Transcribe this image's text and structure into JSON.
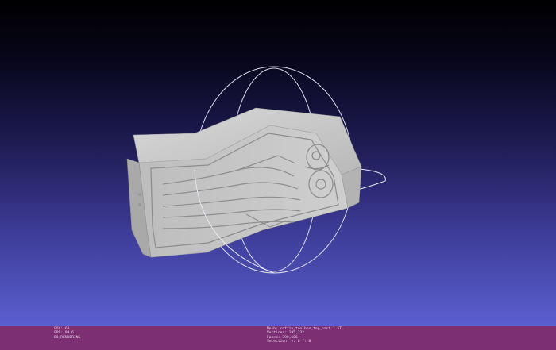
{
  "viewport": {
    "model_description": "3D mesh: coffin-shaped tool box part",
    "background_top": "#000000",
    "background_bottom": "#5b5fd0",
    "mesh_color": "#c9c9c9",
    "trackball_color": "#d9d9e6",
    "trackball_axis_accent": "#8fe08f"
  },
  "status_bar": {
    "color": "#7c2f72",
    "left_lines": [
      "FOV: 60",
      "FPS:   99.6",
      "BO_RENDERING"
    ],
    "right_lines": [
      "Mesh: coffin_toolbox_top_part 1.STL",
      "Vertices: 195,332",
      "Faces: 390,606",
      "Selection: v: 0 f: 0"
    ]
  }
}
